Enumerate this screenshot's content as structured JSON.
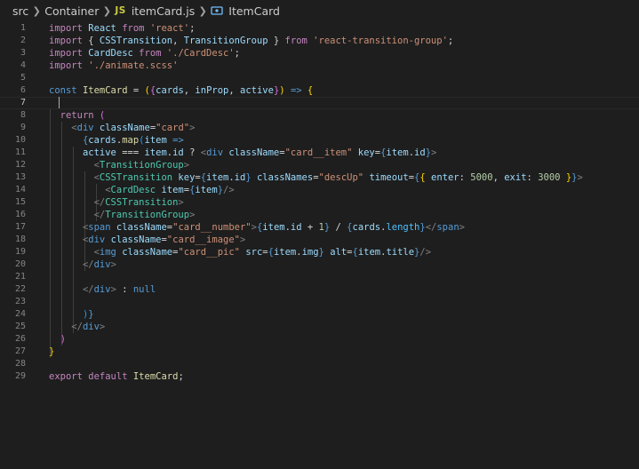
{
  "breadcrumb": {
    "items": [
      "src",
      "Container",
      "itemCard.js",
      "ItemCard"
    ],
    "file_icon": "JS",
    "symbol_icon": "symbol-class-icon"
  },
  "editor": {
    "language": "javascript",
    "lines": [
      {
        "n": "1",
        "tokens": [
          [
            "kw",
            "import"
          ],
          [
            "pl",
            " "
          ],
          [
            "id",
            "React"
          ],
          [
            "pl",
            " "
          ],
          [
            "kw",
            "from"
          ],
          [
            "pl",
            " "
          ],
          [
            "str",
            "'react'"
          ],
          [
            "pl",
            ";"
          ]
        ]
      },
      {
        "n": "2",
        "tokens": [
          [
            "kw",
            "import"
          ],
          [
            "pl",
            " { "
          ],
          [
            "id",
            "CSSTransition"
          ],
          [
            "pl",
            ", "
          ],
          [
            "id",
            "TransitionGroup"
          ],
          [
            "pl",
            " } "
          ],
          [
            "kw",
            "from"
          ],
          [
            "pl",
            " "
          ],
          [
            "str",
            "'react-transition-group'"
          ],
          [
            "pl",
            ";"
          ]
        ]
      },
      {
        "n": "3",
        "tokens": [
          [
            "kw",
            "import"
          ],
          [
            "pl",
            " "
          ],
          [
            "id",
            "CardDesc"
          ],
          [
            "pl",
            " "
          ],
          [
            "kw",
            "from"
          ],
          [
            "pl",
            " "
          ],
          [
            "str",
            "'./CardDesc'"
          ],
          [
            "pl",
            ";"
          ]
        ]
      },
      {
        "n": "4",
        "tokens": [
          [
            "kw",
            "import"
          ],
          [
            "pl",
            " "
          ],
          [
            "str",
            "'./animate.scss'"
          ]
        ]
      },
      {
        "n": "5",
        "tokens": []
      },
      {
        "n": "6",
        "tokens": [
          [
            "kwb",
            "const"
          ],
          [
            "pl",
            " "
          ],
          [
            "fn",
            "ItemCard"
          ],
          [
            "pl",
            " "
          ],
          [
            "pl",
            "="
          ],
          [
            "pl",
            " "
          ],
          [
            "br1",
            "("
          ],
          [
            "br2",
            "{"
          ],
          [
            "id",
            "cards"
          ],
          [
            "pl",
            ", "
          ],
          [
            "id",
            "inProp"
          ],
          [
            "pl",
            ", "
          ],
          [
            "id",
            "active"
          ],
          [
            "br2",
            "}"
          ],
          [
            "br1",
            ")"
          ],
          [
            "pl",
            " "
          ],
          [
            "kwb",
            "=>"
          ],
          [
            "pl",
            " "
          ],
          [
            "br1",
            "{"
          ]
        ]
      },
      {
        "n": "7",
        "tokens": [],
        "current": true
      },
      {
        "n": "8",
        "tokens": [
          [
            "pl",
            "  "
          ],
          [
            "kw",
            "return"
          ],
          [
            "pl",
            " "
          ],
          [
            "br2",
            "("
          ]
        ]
      },
      {
        "n": "9",
        "tokens": [
          [
            "pl",
            "    "
          ],
          [
            "gr",
            "<"
          ],
          [
            "kwb",
            "div"
          ],
          [
            "pl",
            " "
          ],
          [
            "attr",
            "className"
          ],
          [
            "pl",
            "="
          ],
          [
            "str",
            "\"card\""
          ],
          [
            "gr",
            ">"
          ]
        ]
      },
      {
        "n": "10",
        "tokens": [
          [
            "pl",
            "      "
          ],
          [
            "kwb",
            "{"
          ],
          [
            "id",
            "cards"
          ],
          [
            "pl",
            "."
          ],
          [
            "fn",
            "map"
          ],
          [
            "br3",
            "("
          ],
          [
            "id",
            "item"
          ],
          [
            "pl",
            " "
          ],
          [
            "kwb",
            "=>"
          ]
        ]
      },
      {
        "n": "11",
        "tokens": [
          [
            "pl",
            "      "
          ],
          [
            "id",
            "active"
          ],
          [
            "pl",
            " === "
          ],
          [
            "id",
            "item"
          ],
          [
            "pl",
            "."
          ],
          [
            "id",
            "id"
          ],
          [
            "pl",
            " ? "
          ],
          [
            "gr",
            "<"
          ],
          [
            "kwb",
            "div"
          ],
          [
            "pl",
            " "
          ],
          [
            "attr",
            "className"
          ],
          [
            "pl",
            "="
          ],
          [
            "str",
            "\"card__item\""
          ],
          [
            "pl",
            " "
          ],
          [
            "attr",
            "key"
          ],
          [
            "pl",
            "="
          ],
          [
            "kwb",
            "{"
          ],
          [
            "id",
            "item"
          ],
          [
            "pl",
            "."
          ],
          [
            "id",
            "id"
          ],
          [
            "kwb",
            "}"
          ],
          [
            "gr",
            ">"
          ]
        ]
      },
      {
        "n": "12",
        "tokens": [
          [
            "pl",
            "        "
          ],
          [
            "gr",
            "<"
          ],
          [
            "tag",
            "TransitionGroup"
          ],
          [
            "gr",
            ">"
          ]
        ]
      },
      {
        "n": "13",
        "tokens": [
          [
            "pl",
            "        "
          ],
          [
            "gr",
            "<"
          ],
          [
            "tag",
            "CSSTransition"
          ],
          [
            "pl",
            " "
          ],
          [
            "attr",
            "key"
          ],
          [
            "pl",
            "="
          ],
          [
            "kwb",
            "{"
          ],
          [
            "id",
            "item"
          ],
          [
            "pl",
            "."
          ],
          [
            "id",
            "id"
          ],
          [
            "kwb",
            "}"
          ],
          [
            "pl",
            " "
          ],
          [
            "attr",
            "classNames"
          ],
          [
            "pl",
            "="
          ],
          [
            "str",
            "\"descUp\""
          ],
          [
            "pl",
            " "
          ],
          [
            "attr",
            "timeout"
          ],
          [
            "pl",
            "="
          ],
          [
            "kwb",
            "{"
          ],
          [
            "br1",
            "{"
          ],
          [
            "pl",
            " "
          ],
          [
            "id",
            "enter"
          ],
          [
            "pl",
            ": "
          ],
          [
            "num",
            "5000"
          ],
          [
            "pl",
            ", "
          ],
          [
            "id",
            "exit"
          ],
          [
            "pl",
            ": "
          ],
          [
            "num",
            "3000"
          ],
          [
            "pl",
            " "
          ],
          [
            "br1",
            "}"
          ],
          [
            "kwb",
            "}"
          ],
          [
            "gr",
            ">"
          ]
        ]
      },
      {
        "n": "14",
        "tokens": [
          [
            "pl",
            "          "
          ],
          [
            "gr",
            "<"
          ],
          [
            "tag",
            "CardDesc"
          ],
          [
            "pl",
            " "
          ],
          [
            "attr",
            "item"
          ],
          [
            "pl",
            "="
          ],
          [
            "kwb",
            "{"
          ],
          [
            "id",
            "item"
          ],
          [
            "kwb",
            "}"
          ],
          [
            "gr",
            "/>"
          ]
        ]
      },
      {
        "n": "15",
        "tokens": [
          [
            "pl",
            "        "
          ],
          [
            "gr",
            "</"
          ],
          [
            "tag",
            "CSSTransition"
          ],
          [
            "gr",
            ">"
          ]
        ]
      },
      {
        "n": "16",
        "tokens": [
          [
            "pl",
            "        "
          ],
          [
            "gr",
            "</"
          ],
          [
            "tag",
            "TransitionGroup"
          ],
          [
            "gr",
            ">"
          ]
        ]
      },
      {
        "n": "17",
        "tokens": [
          [
            "pl",
            "      "
          ],
          [
            "gr",
            "<"
          ],
          [
            "kwb",
            "span"
          ],
          [
            "pl",
            " "
          ],
          [
            "attr",
            "className"
          ],
          [
            "pl",
            "="
          ],
          [
            "str",
            "\"card__number\""
          ],
          [
            "gr",
            ">"
          ],
          [
            "kwb",
            "{"
          ],
          [
            "id",
            "item"
          ],
          [
            "pl",
            "."
          ],
          [
            "id",
            "id"
          ],
          [
            "pl",
            " + "
          ],
          [
            "num",
            "1"
          ],
          [
            "kwb",
            "}"
          ],
          [
            "pl",
            " / "
          ],
          [
            "kwb",
            "{"
          ],
          [
            "id",
            "cards"
          ],
          [
            "pl",
            "."
          ],
          [
            "const",
            "length"
          ],
          [
            "kwb",
            "}"
          ],
          [
            "gr",
            "</"
          ],
          [
            "kwb",
            "span"
          ],
          [
            "gr",
            ">"
          ]
        ]
      },
      {
        "n": "18",
        "tokens": [
          [
            "pl",
            "      "
          ],
          [
            "gr",
            "<"
          ],
          [
            "kwb",
            "div"
          ],
          [
            "pl",
            " "
          ],
          [
            "attr",
            "className"
          ],
          [
            "pl",
            "="
          ],
          [
            "str",
            "\"card__image\""
          ],
          [
            "gr",
            ">"
          ]
        ]
      },
      {
        "n": "19",
        "tokens": [
          [
            "pl",
            "        "
          ],
          [
            "gr",
            "<"
          ],
          [
            "kwb",
            "img"
          ],
          [
            "pl",
            " "
          ],
          [
            "attr",
            "className"
          ],
          [
            "pl",
            "="
          ],
          [
            "str",
            "\"card__pic\""
          ],
          [
            "pl",
            " "
          ],
          [
            "attr",
            "src"
          ],
          [
            "pl",
            "="
          ],
          [
            "kwb",
            "{"
          ],
          [
            "id",
            "item"
          ],
          [
            "pl",
            "."
          ],
          [
            "id",
            "img"
          ],
          [
            "kwb",
            "}"
          ],
          [
            "pl",
            " "
          ],
          [
            "attr",
            "alt"
          ],
          [
            "pl",
            "="
          ],
          [
            "kwb",
            "{"
          ],
          [
            "id",
            "item"
          ],
          [
            "pl",
            "."
          ],
          [
            "id",
            "title"
          ],
          [
            "kwb",
            "}"
          ],
          [
            "gr",
            "/>"
          ]
        ]
      },
      {
        "n": "20",
        "tokens": [
          [
            "pl",
            "      "
          ],
          [
            "gr",
            "</"
          ],
          [
            "kwb",
            "div"
          ],
          [
            "gr",
            ">"
          ]
        ]
      },
      {
        "n": "21",
        "tokens": []
      },
      {
        "n": "22",
        "tokens": [
          [
            "pl",
            "      "
          ],
          [
            "gr",
            "</"
          ],
          [
            "kwb",
            "div"
          ],
          [
            "gr",
            ">"
          ],
          [
            "pl",
            " : "
          ],
          [
            "kwb",
            "null"
          ]
        ]
      },
      {
        "n": "23",
        "tokens": []
      },
      {
        "n": "24",
        "tokens": [
          [
            "pl",
            "      "
          ],
          [
            "br3",
            ")"
          ],
          [
            "kwb",
            "}"
          ]
        ]
      },
      {
        "n": "25",
        "tokens": [
          [
            "pl",
            "    "
          ],
          [
            "gr",
            "</"
          ],
          [
            "kwb",
            "div"
          ],
          [
            "gr",
            ">"
          ]
        ]
      },
      {
        "n": "26",
        "tokens": [
          [
            "pl",
            "  "
          ],
          [
            "br2",
            ")"
          ]
        ]
      },
      {
        "n": "27",
        "tokens": [
          [
            "br1",
            "}"
          ]
        ]
      },
      {
        "n": "28",
        "tokens": []
      },
      {
        "n": "29",
        "tokens": [
          [
            "kw",
            "export"
          ],
          [
            "pl",
            " "
          ],
          [
            "kw",
            "default"
          ],
          [
            "pl",
            " "
          ],
          [
            "fn",
            "ItemCard"
          ],
          [
            "pl",
            ";"
          ]
        ]
      }
    ]
  }
}
